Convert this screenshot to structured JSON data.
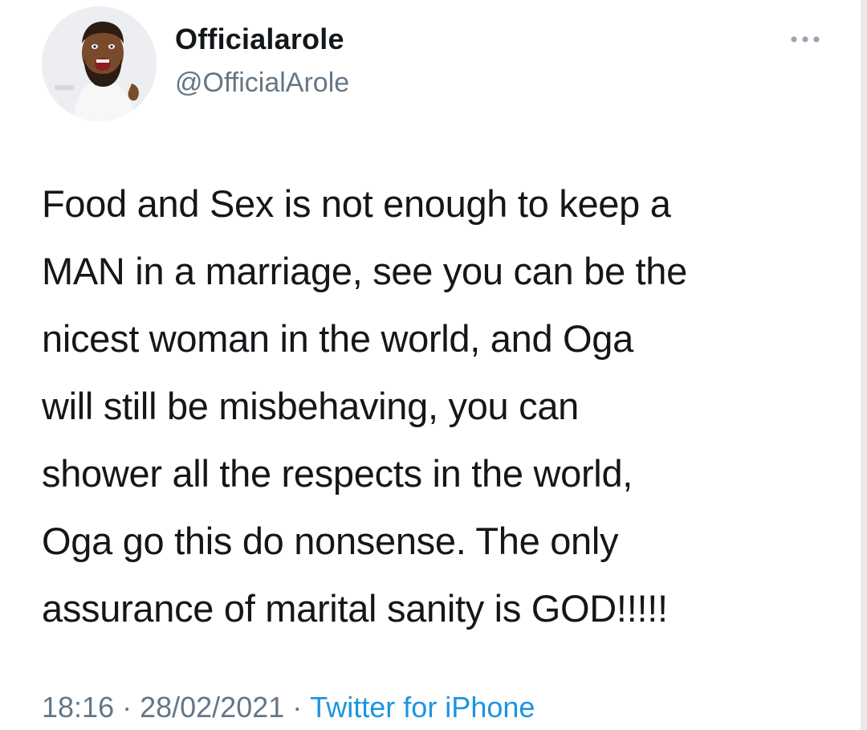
{
  "tweet": {
    "author": {
      "display_name": "Officialarole",
      "handle": "@OfficialArole",
      "avatar_icon": "profile-photo-smiling-man"
    },
    "more_icon": "more-options-icon",
    "text": "Food and Sex is not enough to keep a\nMAN in a marriage, see you can be the\nnicest woman in the world, and Oga\nwill still be misbehaving, you can\nshower all the respects in the world,\nOga go this do nonsense. The only\nassurance of marital sanity is GOD!!!!!",
    "time": "18:16",
    "separator": "·",
    "date": "28/02/2021",
    "source": "Twitter for iPhone"
  },
  "colors": {
    "text": "#14171a",
    "secondary": "#657786",
    "link": "#1b95e0"
  }
}
